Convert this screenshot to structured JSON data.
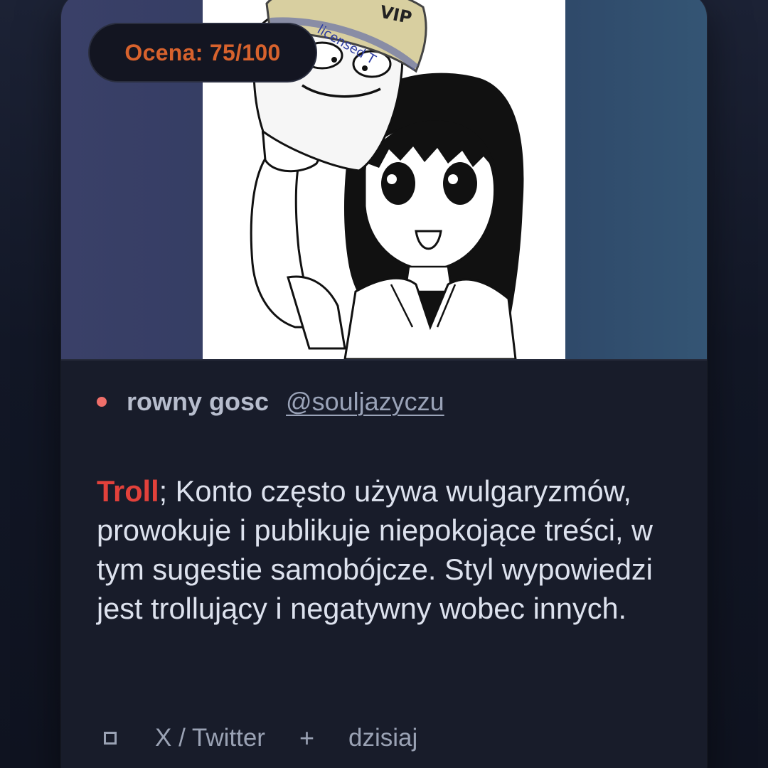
{
  "post": {
    "score_label": "Ocena: 75/100",
    "author_name": "rowny gosc",
    "author_handle": "@souljazyczu",
    "tag": "Troll",
    "description": "; Konto często używa wulgaryzmów, prowokuje i publikuje niepokojące treści, w tym sugestie samobójcze. Styl wypowiedzi jest trollujący i negatywny wobec innych.",
    "image": {
      "cap_text": "VIP",
      "cap_band_text": "licensed T"
    }
  },
  "footer": {
    "source_icon": "square-icon",
    "source": "X / Twitter",
    "separator_icon": "plus-icon",
    "date": "dzisiaj"
  },
  "colors": {
    "score": "#d7622d",
    "tag": "#e2413b",
    "status_dot": "#ef6f6a",
    "card": "#181c2a"
  }
}
